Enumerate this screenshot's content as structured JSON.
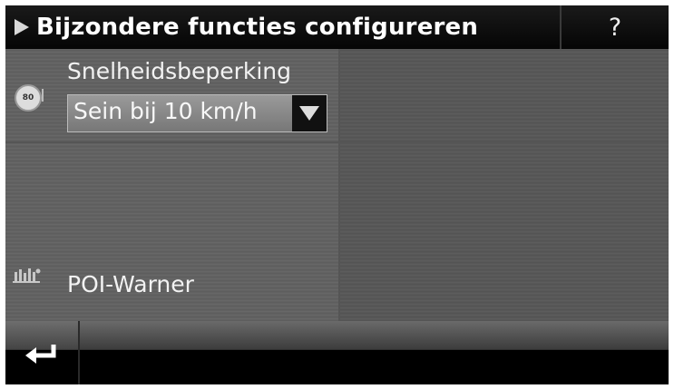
{
  "header": {
    "title": "Bijzondere functies configureren",
    "help_label": "?"
  },
  "speed_limit": {
    "icon_text": "80",
    "label": "Snelheidsbeperking",
    "dropdown_value": "Sein bij 10 km/h"
  },
  "poi_warner": {
    "label": "POI-Warner"
  },
  "footer": {
    "back_icon": "return-arrow-icon"
  }
}
